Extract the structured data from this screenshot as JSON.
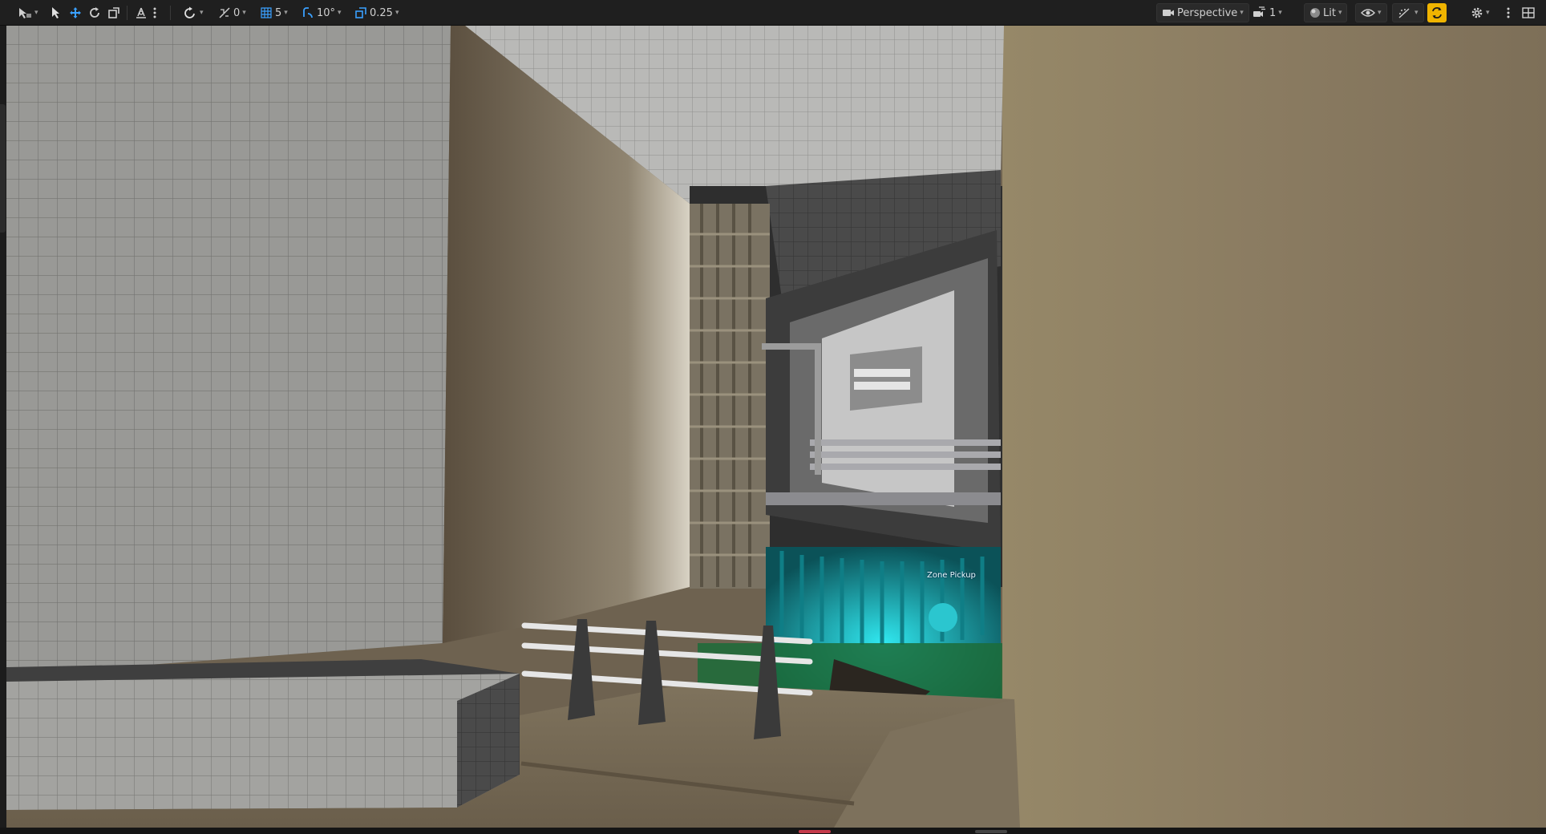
{
  "toolbar": {
    "left": {
      "select_mode_icon": "select-mode-icon",
      "transform_tools": [
        "select-arrow-icon",
        "translate-icon",
        "rotate-icon",
        "scale-icon"
      ],
      "surface_snap_icon": "surface-snap-icon",
      "snap_rotation_value": "0",
      "grid_snap_value": "5",
      "rotation_snap_value": "10°",
      "scale_snap_value": "0.25"
    },
    "right": {
      "perspective_label": "Perspective",
      "camera_speed_value": "1",
      "view_mode_label": "Lit"
    }
  },
  "viewport": {
    "zone_label": "Zone Pickup"
  },
  "colors": {
    "toolbar_bg": "#1f1f1f",
    "accent": "#f0b400",
    "snap_blue": "#3aa0ff",
    "cyan_glow": "#19d4e0",
    "wall_tan": "#8a7b63",
    "grid_grey": "#9c9c99"
  }
}
